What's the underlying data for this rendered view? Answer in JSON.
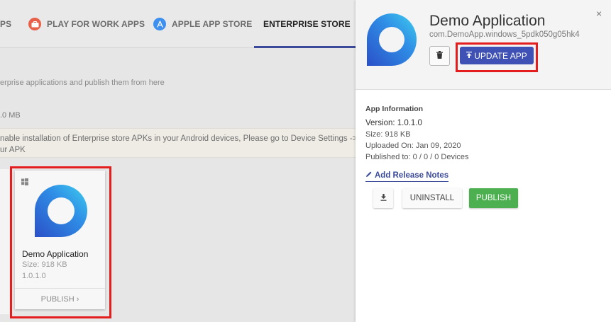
{
  "tabs": [
    {
      "label": "PS",
      "icon": "none"
    },
    {
      "label": "PLAY FOR WORK APPS",
      "icon": "briefcase-icon"
    },
    {
      "label": "APPLE APP STORE",
      "icon": "app-store-icon"
    },
    {
      "label": "ENTERPRISE STORE",
      "icon": "none",
      "active": true
    }
  ],
  "main": {
    "description": "erprise applications and publish them from here",
    "storage": ".0 MB",
    "notice_line1": "nable installation of Enterprise store APKs in your Android devices, Please go to Device Settings ->",
    "notice_line2": "ur APK"
  },
  "card": {
    "os_icon": "windows-icon",
    "name": "Demo Application",
    "size": "Size: 918 KB",
    "version": "1.0.1.0",
    "publish_label": "PUBLISH",
    "publish_chevron": "›"
  },
  "panel": {
    "close": "×",
    "title": "Demo Application",
    "package": "com.DemoApp.windows_5pdk050g05hk4",
    "update_label": "UPDATE APP",
    "info_heading": "App Information",
    "version": "Version: 1.0.1.0",
    "size": "Size: 918 KB",
    "uploaded": "Uploaded On: Jan 09, 2020",
    "published": "Published to: 0 / 0 / 0 Devices",
    "release_notes": "Add Release Notes",
    "uninstall_label": "UNINSTALL",
    "publish_label": "PUBLISH"
  },
  "colors": {
    "accent": "#3f51b5",
    "publish_green": "#4caf50",
    "highlight_red": "#e41e1e"
  }
}
